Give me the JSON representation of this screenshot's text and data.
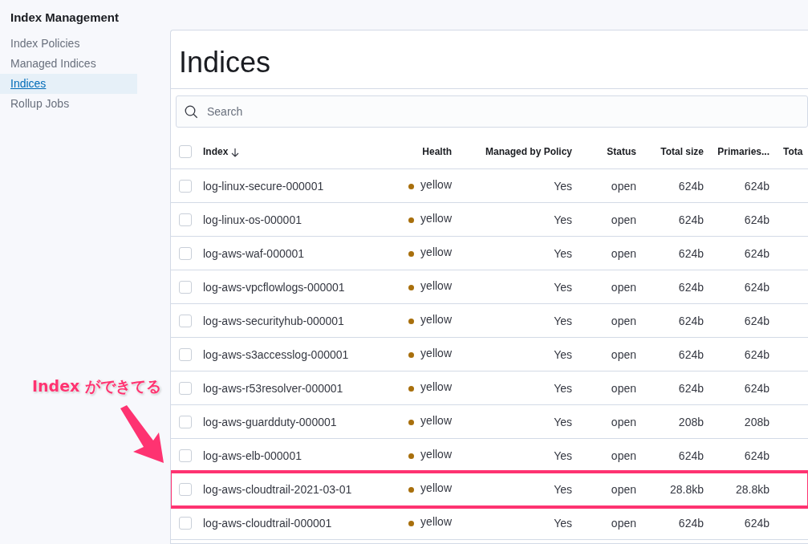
{
  "sidebar": {
    "title": "Index Management",
    "items": [
      {
        "label": "Index Policies",
        "selected": false
      },
      {
        "label": "Managed Indices",
        "selected": false
      },
      {
        "label": "Indices",
        "selected": true
      },
      {
        "label": "Rollup Jobs",
        "selected": false
      }
    ]
  },
  "page": {
    "title": "Indices",
    "search": {
      "placeholder": "Search"
    }
  },
  "table": {
    "select_all": {
      "checked": false
    },
    "columns": [
      {
        "label": "Index",
        "sorted": true
      },
      {
        "label": "Health",
        "sorted": false
      },
      {
        "label": "Managed by Policy",
        "sorted": false
      },
      {
        "label": "Status",
        "sorted": false
      },
      {
        "label": "Total size",
        "sorted": false
      },
      {
        "label": "Primaries...",
        "sorted": false
      },
      {
        "label": "Tota",
        "sorted": false
      }
    ],
    "rows": [
      {
        "checked": false,
        "highlighted": false,
        "index": "log-linux-secure-000001",
        "health": "yellow",
        "color": "#a86f0c",
        "managed": "Yes",
        "status": "open",
        "total_size": "624b",
        "primaries": "624b"
      },
      {
        "checked": false,
        "highlighted": false,
        "index": "log-linux-os-000001",
        "health": "yellow",
        "color": "#a86f0c",
        "managed": "Yes",
        "status": "open",
        "total_size": "624b",
        "primaries": "624b"
      },
      {
        "checked": false,
        "highlighted": false,
        "index": "log-aws-waf-000001",
        "health": "yellow",
        "color": "#a86f0c",
        "managed": "Yes",
        "status": "open",
        "total_size": "624b",
        "primaries": "624b"
      },
      {
        "checked": false,
        "highlighted": false,
        "index": "log-aws-vpcflowlogs-000001",
        "health": "yellow",
        "color": "#a86f0c",
        "managed": "Yes",
        "status": "open",
        "total_size": "624b",
        "primaries": "624b"
      },
      {
        "checked": false,
        "highlighted": false,
        "index": "log-aws-securityhub-000001",
        "health": "yellow",
        "color": "#a86f0c",
        "managed": "Yes",
        "status": "open",
        "total_size": "624b",
        "primaries": "624b"
      },
      {
        "checked": false,
        "highlighted": false,
        "index": "log-aws-s3accesslog-000001",
        "health": "yellow",
        "color": "#a86f0c",
        "managed": "Yes",
        "status": "open",
        "total_size": "624b",
        "primaries": "624b"
      },
      {
        "checked": false,
        "highlighted": false,
        "index": "log-aws-r53resolver-000001",
        "health": "yellow",
        "color": "#a86f0c",
        "managed": "Yes",
        "status": "open",
        "total_size": "624b",
        "primaries": "624b"
      },
      {
        "checked": false,
        "highlighted": false,
        "index": "log-aws-guardduty-000001",
        "health": "yellow",
        "color": "#a86f0c",
        "managed": "Yes",
        "status": "open",
        "total_size": "208b",
        "primaries": "208b"
      },
      {
        "checked": false,
        "highlighted": false,
        "index": "log-aws-elb-000001",
        "health": "yellow",
        "color": "#a86f0c",
        "managed": "Yes",
        "status": "open",
        "total_size": "624b",
        "primaries": "624b"
      },
      {
        "checked": false,
        "highlighted": true,
        "index": "log-aws-cloudtrail-2021-03-01",
        "health": "yellow",
        "color": "#a86f0c",
        "managed": "Yes",
        "status": "open",
        "total_size": "28.8kb",
        "primaries": "28.8kb"
      },
      {
        "checked": false,
        "highlighted": false,
        "index": "log-aws-cloudtrail-000001",
        "health": "yellow",
        "color": "#a86f0c",
        "managed": "Yes",
        "status": "open",
        "total_size": "624b",
        "primaries": "624b"
      }
    ]
  },
  "annotation": {
    "text": "Index ができてる"
  }
}
